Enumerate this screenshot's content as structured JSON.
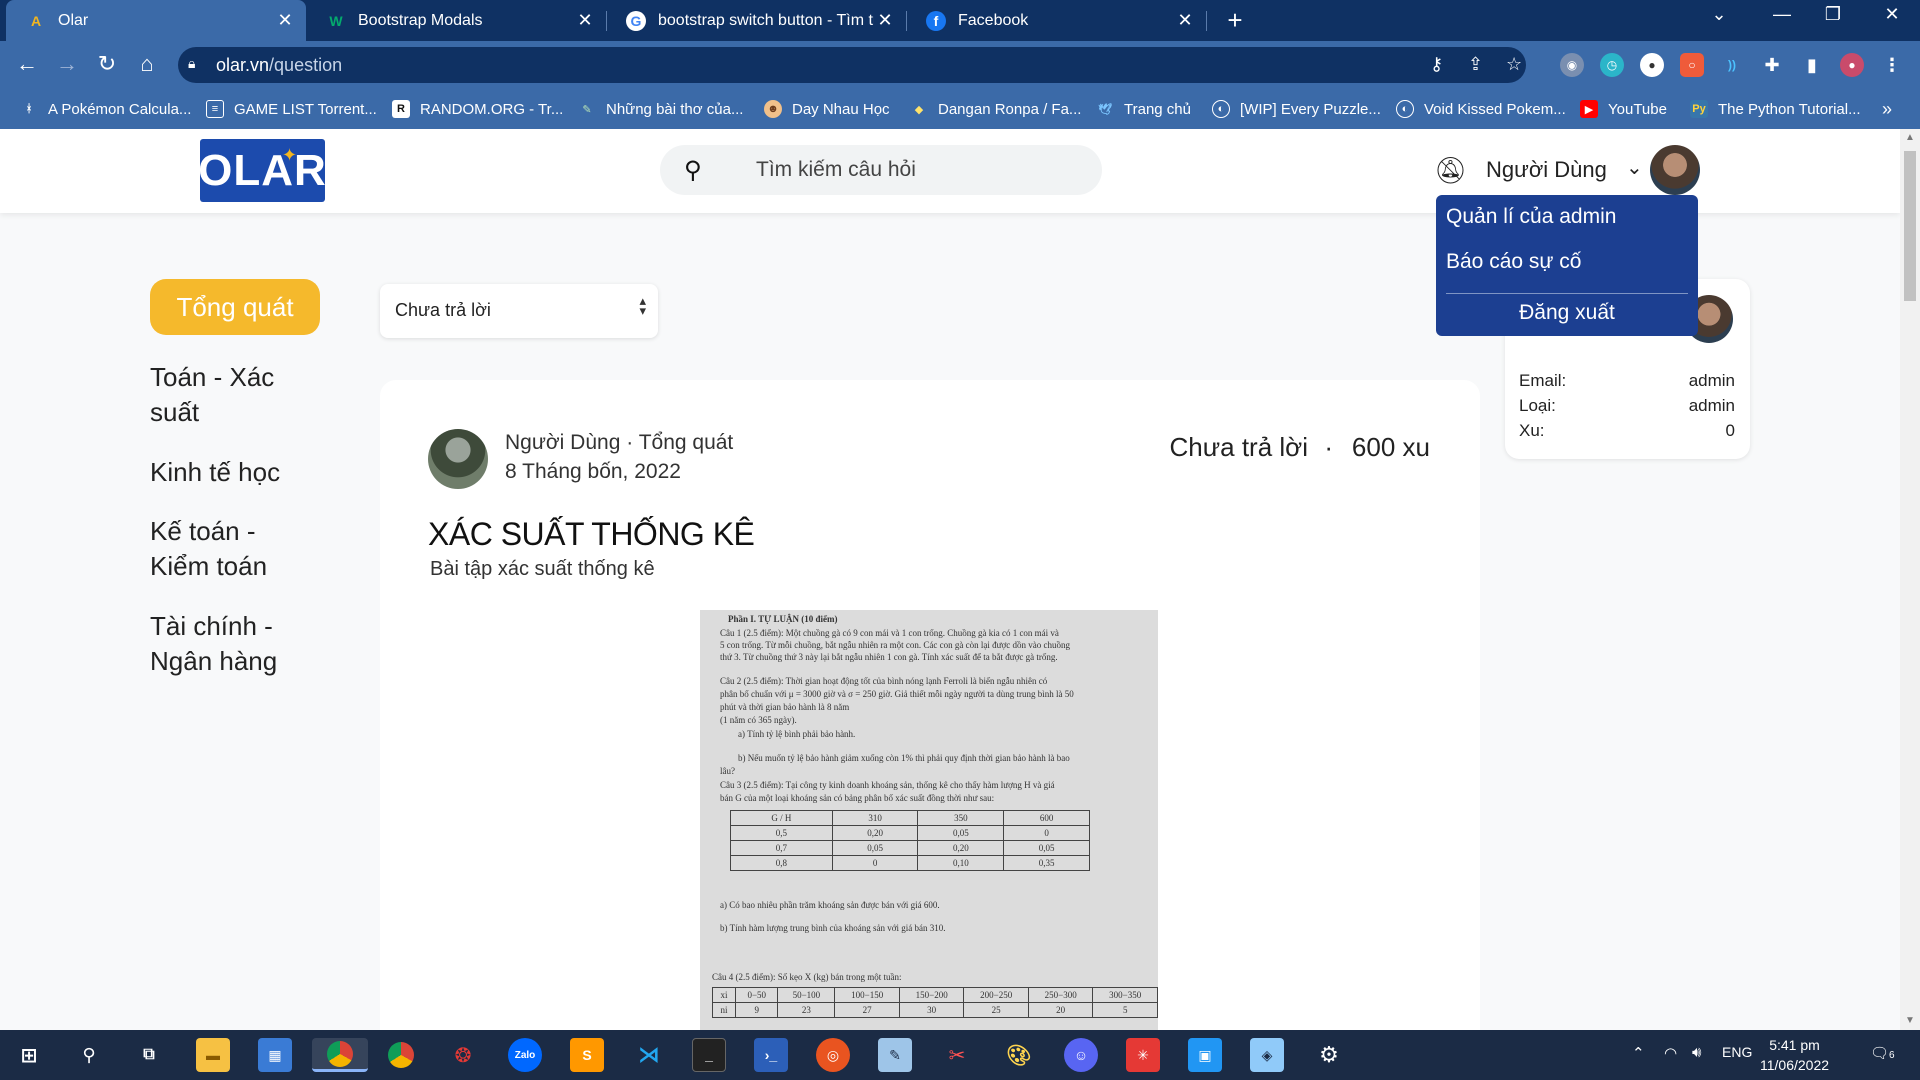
{
  "browser": {
    "tabs": [
      {
        "title": "Olar",
        "favicon": "olar-logo-icon",
        "active": true
      },
      {
        "title": "Bootstrap Modals",
        "favicon": "w3schools-icon",
        "active": false
      },
      {
        "title": "bootstrap switch button - Tìm trê",
        "favicon": "google-icon",
        "active": false
      },
      {
        "title": "Facebook",
        "favicon": "facebook-icon",
        "active": false
      }
    ],
    "url_host": "olar.vn",
    "url_path": "/question",
    "bookmarks": [
      "A Pokémon Calcula...",
      "GAME LIST Torrent...",
      "RANDOM.ORG - Tr...",
      "Những bài thơ của...",
      "Day Nhau Học",
      "Dangan Ronpa / Fa...",
      "Trang chủ",
      "[WIP] Every Puzzle...",
      "Void Kissed Pokem...",
      "YouTube",
      "The Python Tutorial..."
    ],
    "colors": {
      "frame": "#0f3163",
      "toolbar": "#3b6aa8"
    }
  },
  "site": {
    "logo_text": "OLAR",
    "search_placeholder": "Tìm kiếm câu hỏi",
    "username": "Người Dùng",
    "menu": {
      "admin": "Quản lí của admin",
      "report": "Báo cáo sự cố",
      "logout": "Đăng xuất"
    },
    "categories": {
      "active": "Tổng quát",
      "items": [
        "Toán - Xác suất",
        "Kinh tế học",
        "Kế toán - Kiểm toán",
        "Tài chính - Ngân hàng"
      ]
    },
    "filter": {
      "selected": "Chưa trả lời"
    },
    "post": {
      "author": "Người Dùng",
      "category": "Tổng quát",
      "date": "8 Tháng bốn, 2022",
      "status": "Chưa trả lời",
      "coins": "600 xu",
      "title": "XÁC SUẤT THỐNG KÊ",
      "description": "Bài tập xác suất thống kê"
    },
    "profile": {
      "email_label": "Email:",
      "email": "admin",
      "type_label": "Loại:",
      "type": "admin",
      "coins_label": "Xu:",
      "coins": "0"
    },
    "colors": {
      "accent": "#f5b92c",
      "brand": "#1c4bad",
      "menu": "#1c3f91"
    }
  },
  "paper": {
    "lines": [
      "Phần I. TỰ LUẬN (10 điểm)",
      "Câu 1 (2.5 điểm): Một chuồng gà có 9 con mái và 1 con trống. Chuồng gà kia có 1 con mái và",
      "5 con trống. Từ mỗi chuồng, bắt ngẫu nhiên ra một con. Các con gà còn lại được dồn vào chuồng",
      "thứ 3. Từ chuồng thứ 3 này lại bắt ngẫu nhiên 1 con gà. Tính xác suất để ta bắt được gà trống.",
      "Câu 2 (2.5 điểm): Thời gian hoạt động tốt của bình nóng lạnh Ferroli là biến ngẫu nhiên có",
      "phân bố chuẩn với μ = 3000 giờ và σ = 250 giờ. Giả thiết mỗi ngày người ta dùng trung bình là 50",
      "phút và thời gian bảo hành là 8 năm",
      "(1 năm có 365 ngày).",
      "a) Tính tỷ lệ bình phải bảo hành.",
      "b) Nếu muốn tỷ lệ bảo hành giảm xuống còn 1% thì phải quy định thời gian bảo hành là bao",
      "lâu?",
      "Câu 3 (2.5 điểm): Tại công ty kinh doanh khoáng sản, thống kê cho thấy hàm lượng H và giá",
      "bán G của một loại khoáng sản có bảng phân bố xác suất đồng thời như sau:",
      "a) Có bao nhiêu phần trăm khoáng sản được bán với giá 600.",
      "b) Tính hàm lượng trung bình của khoáng sản với giá bán 310.",
      "Câu 4 (2.5 điểm): Số kẹo X (kg) bán trong một tuần:"
    ],
    "table3": {
      "header": [
        "G / H",
        "310",
        "350",
        "600"
      ],
      "rows": [
        [
          "0,5",
          "0,20",
          "0,05",
          "0"
        ],
        [
          "0,7",
          "0,05",
          "0,20",
          "0,05"
        ],
        [
          "0,8",
          "0",
          "0,10",
          "0,35"
        ]
      ]
    },
    "table4": {
      "header": [
        "xi",
        "0−50",
        "50−100",
        "100−150",
        "150−200",
        "200−250",
        "250−300",
        "300−350"
      ],
      "row": [
        "ni",
        "9",
        "23",
        "27",
        "30",
        "25",
        "20",
        "5"
      ]
    }
  },
  "taskbar": {
    "apps": [
      "start-icon",
      "search-icon",
      "task-view-icon",
      "file-explorer-icon",
      "store-icon",
      "chrome-icon",
      "chrome-alt-icon",
      "garena-icon",
      "zalo-icon",
      "sublime-icon",
      "vscode-icon",
      "terminal-icon",
      "powershell-icon",
      "ubuntu-icon",
      "notes-icon",
      "paint-icon",
      "brush-icon",
      "discord-icon",
      "app-icon",
      "window-icon",
      "cube-icon",
      "settings-icon"
    ],
    "zalo_label": "Zalo",
    "language": "ENG",
    "time": "5:41 pm",
    "date": "11/06/2022",
    "notifications": "6"
  }
}
